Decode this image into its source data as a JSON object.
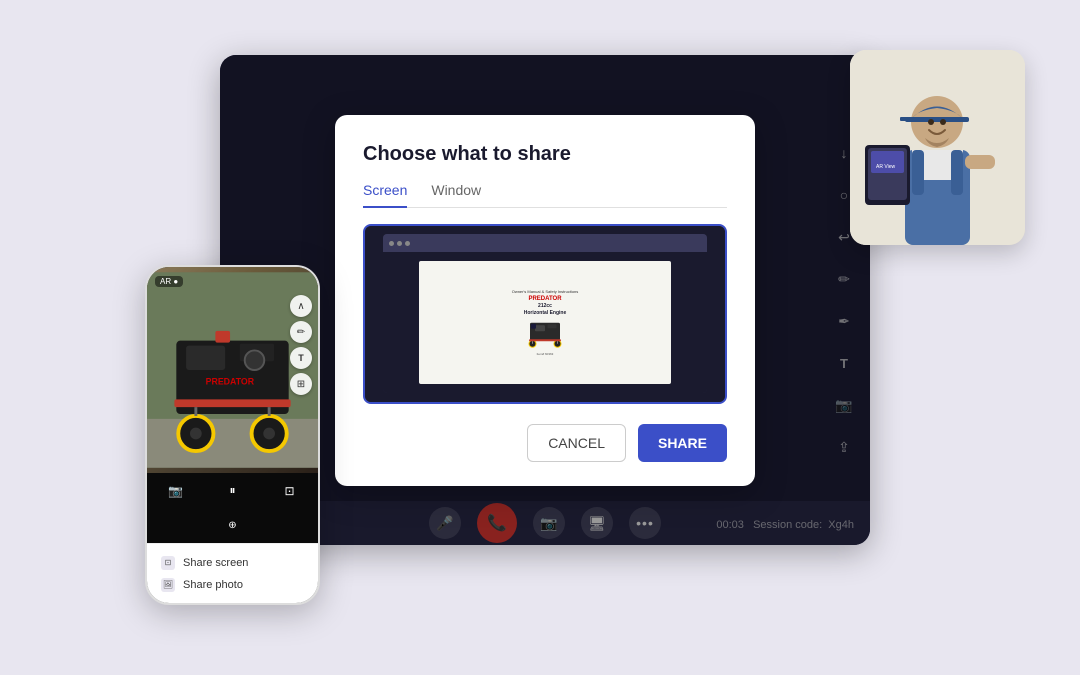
{
  "page": {
    "background_color": "#e8e6f0"
  },
  "dialog": {
    "title": "Choose what to share",
    "tabs": [
      {
        "id": "screen",
        "label": "Screen",
        "active": true
      },
      {
        "id": "window",
        "label": "Window",
        "active": false
      }
    ],
    "cancel_label": "CANCEL",
    "share_label": "SHARE"
  },
  "manual": {
    "owner_manual": "Owner's Manual & Safety Instructions",
    "brand": "PREDATOR",
    "model": "212cc",
    "engine_type": "Horizontal Engine"
  },
  "phone": {
    "ar_badge": "AR ●",
    "share_screen_label": "Share screen",
    "share_photo_label": "Share photo"
  },
  "toolbar": {
    "session_time": "00:03",
    "session_code_label": "Session code:",
    "session_code": "Xg4h"
  },
  "icons": {
    "mic": "🎤",
    "end_call": "📞",
    "cam": "📷",
    "screen_share": "🖥",
    "more": "⋯",
    "arrow_up": "↑",
    "circle": "○",
    "undo": "↩",
    "pencil": "✏",
    "pen": "🖊",
    "text": "T",
    "camera": "📷",
    "share": "⇪",
    "chevron_up": "∧",
    "pause": "⏸",
    "screenshot": "⊡"
  }
}
